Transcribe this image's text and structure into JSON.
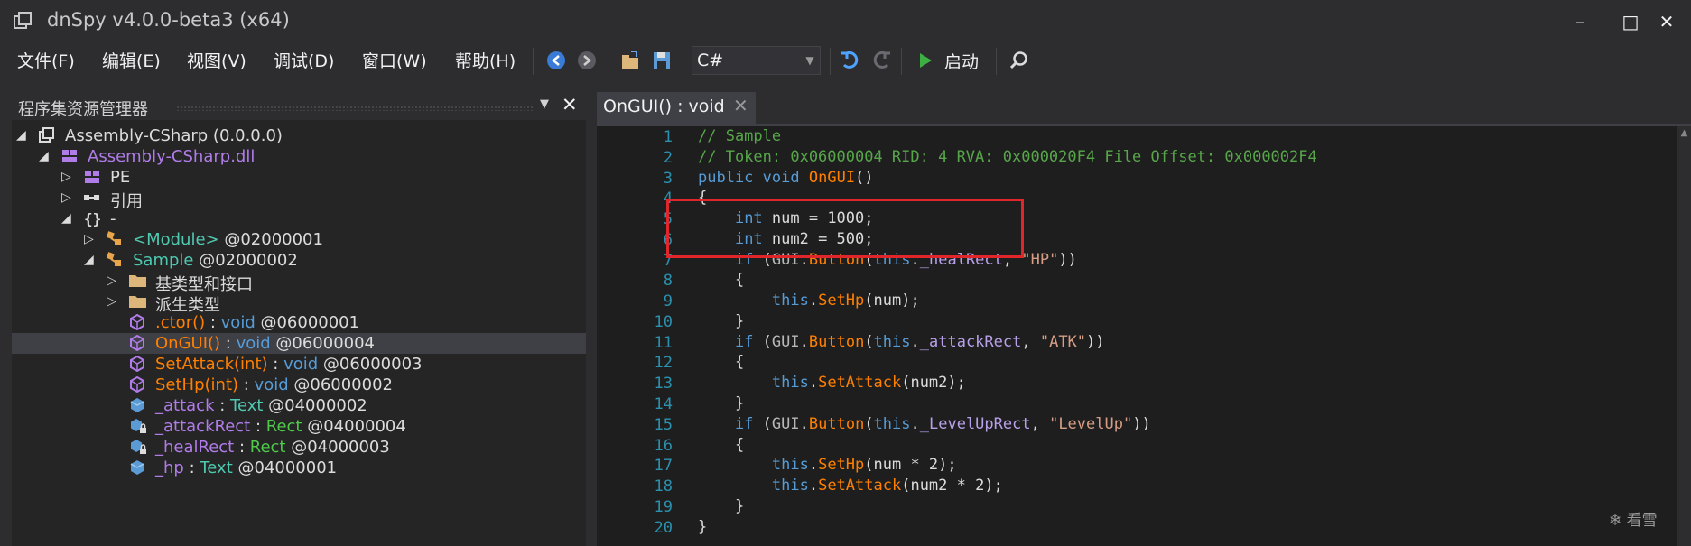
{
  "window": {
    "title": "dnSpy v4.0.0-beta3 (x64)",
    "minimize": "–",
    "maximize": "□",
    "close": "✕"
  },
  "menu": [
    "文件(F)",
    "编辑(E)",
    "视图(V)",
    "调试(D)",
    "窗口(W)",
    "帮助(H)"
  ],
  "toolbar": {
    "language": "C#",
    "start_label": "启动"
  },
  "left_panel": {
    "title": "程序集资源管理器",
    "tree": [
      {
        "arrow": "◢",
        "icon": "assembly-icon",
        "label": "Assembly-CSharp (0.0.0.0)",
        "suffix": "",
        "color": "#dcdcdc"
      },
      {
        "arrow": "◢",
        "icon": "module-icon",
        "label": "Assembly-CSharp.dll",
        "suffix": "",
        "color": "#b07ce8"
      },
      {
        "arrow": "▷",
        "icon": "pe-icon",
        "label": "PE",
        "suffix": "",
        "color": "#dcdcdc"
      },
      {
        "arrow": "▷",
        "icon": "references-icon",
        "label": "引用",
        "suffix": "",
        "color": "#dcdcdc"
      },
      {
        "arrow": "◢",
        "icon": "namespace-icon",
        "label": "-",
        "suffix": "",
        "color": "#dcdcdc"
      },
      {
        "arrow": "▷",
        "icon": "class-icon",
        "label": "<Module>",
        "suffix": " @02000001",
        "color": "#4ec9b0"
      },
      {
        "arrow": "◢",
        "icon": "class-icon",
        "label": "Sample",
        "suffix": " @02000002",
        "color": "#4ec9b0"
      },
      {
        "arrow": "▷",
        "icon": "folder-icon",
        "label": "基类型和接口",
        "suffix": "",
        "color": "#dcdcdc"
      },
      {
        "arrow": "▷",
        "icon": "folder-icon",
        "label": "派生类型",
        "suffix": "",
        "color": "#dcdcdc"
      },
      {
        "arrow": "",
        "icon": "method-icon",
        "label": ".ctor()",
        "suffix": " : void @06000001",
        "color": "#ff8000"
      },
      {
        "arrow": "",
        "icon": "method-icon",
        "label": "OnGUI()",
        "suffix": " : void @06000004",
        "color": "#ff8000"
      },
      {
        "arrow": "",
        "icon": "method-icon",
        "label": "SetAttack(int)",
        "suffix": " : void @06000003",
        "color": "#ff8000"
      },
      {
        "arrow": "",
        "icon": "method-icon",
        "label": "SetHp(int)",
        "suffix": " : void @06000002",
        "color": "#ff8000"
      },
      {
        "arrow": "",
        "icon": "field-icon",
        "label": "_attack",
        "suffix": " : Text @04000002",
        "color": "#b07ce8"
      },
      {
        "arrow": "",
        "icon": "private-field-icon",
        "label": "_attackRect",
        "suffix": " : Rect @04000004",
        "color": "#b07ce8"
      },
      {
        "arrow": "",
        "icon": "private-field-icon",
        "label": "_healRect",
        "suffix": " : Rect @04000003",
        "color": "#b07ce8"
      },
      {
        "arrow": "",
        "icon": "field-icon",
        "label": "_hp",
        "suffix": " : Text @04000001",
        "color": "#b07ce8"
      }
    ],
    "selected_index": 10
  },
  "editor": {
    "tab_label": "OnGUI() : void",
    "tab_close": "✕",
    "code_lines": [
      "// Sample",
      "// Token: 0x06000004 RID: 4 RVA: 0x000020F4 File Offset: 0x000002F4",
      "public void OnGUI()",
      "{",
      "    int num = 1000;",
      "    int num2 = 500;",
      "    if (GUI.Button(this._healRect, \"HP\"))",
      "    {",
      "        this.SetHp(num);",
      "    }",
      "    if (GUI.Button(this._attackRect, \"ATK\"))",
      "    {",
      "        this.SetAttack(num2);",
      "    }",
      "    if (GUI.Button(this._LevelUpRect, \"LevelUp\"))",
      "    {",
      "        this.SetHp(num * 2);",
      "        this.SetAttack(num2 * 2);",
      "    }",
      "}"
    ]
  },
  "watermark": "看雪"
}
